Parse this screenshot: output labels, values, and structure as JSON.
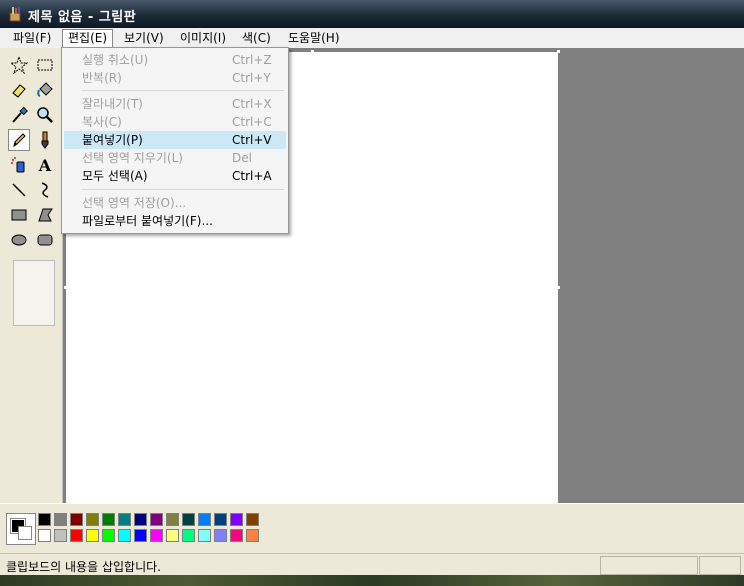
{
  "window": {
    "title": "제목 없음 - 그림판"
  },
  "menubar": [
    {
      "label": "파일(F)"
    },
    {
      "label": "편집(E)"
    },
    {
      "label": "보기(V)"
    },
    {
      "label": "이미지(I)"
    },
    {
      "label": "색(C)"
    },
    {
      "label": "도움말(H)"
    }
  ],
  "edit_menu": {
    "items": [
      {
        "label": "실행 취소(U)",
        "shortcut": "Ctrl+Z"
      },
      {
        "label": "반복(R)",
        "shortcut": "Ctrl+Y"
      },
      {
        "label": "잘라내기(T)",
        "shortcut": "Ctrl+X"
      },
      {
        "label": "복사(C)",
        "shortcut": "Ctrl+C"
      },
      {
        "label": "붙여넣기(P)",
        "shortcut": "Ctrl+V"
      },
      {
        "label": "선택 영역 지우기(L)",
        "shortcut": "Del"
      },
      {
        "label": "모두 선택(A)",
        "shortcut": "Ctrl+A"
      },
      {
        "label": "선택 영역 저장(O)...",
        "shortcut": ""
      },
      {
        "label": "파일로부터 붙여넣기(F)...",
        "shortcut": ""
      }
    ]
  },
  "tools": [
    {
      "icon": "free-select-icon"
    },
    {
      "icon": "rect-select-icon"
    },
    {
      "icon": "eraser-icon"
    },
    {
      "icon": "fill-icon"
    },
    {
      "icon": "color-picker-icon"
    },
    {
      "icon": "magnifier-icon"
    },
    {
      "icon": "pencil-icon"
    },
    {
      "icon": "brush-icon"
    },
    {
      "icon": "airbrush-icon"
    },
    {
      "icon": "text-icon",
      "glyph": "A"
    },
    {
      "icon": "line-icon"
    },
    {
      "icon": "curve-icon"
    },
    {
      "icon": "rectangle-icon"
    },
    {
      "icon": "polygon-icon"
    },
    {
      "icon": "ellipse-icon"
    },
    {
      "icon": "rounded-rect-icon"
    }
  ],
  "palette": {
    "foreground": "#000000",
    "background": "#ffffff",
    "row1": [
      "#000000",
      "#808080",
      "#800000",
      "#808000",
      "#008000",
      "#008080",
      "#000080",
      "#800080",
      "#808040",
      "#004040",
      "#0080ff",
      "#004080",
      "#8000ff",
      "#804000"
    ],
    "row2": [
      "#ffffff",
      "#c0c0c0",
      "#ff0000",
      "#ffff00",
      "#00ff00",
      "#00ffff",
      "#0000ff",
      "#ff00ff",
      "#ffff80",
      "#00ff80",
      "#80ffff",
      "#8080ff",
      "#ff0080",
      "#ff8040"
    ]
  },
  "statusbar": {
    "message": "클립보드의 내용을 삽입합니다."
  }
}
